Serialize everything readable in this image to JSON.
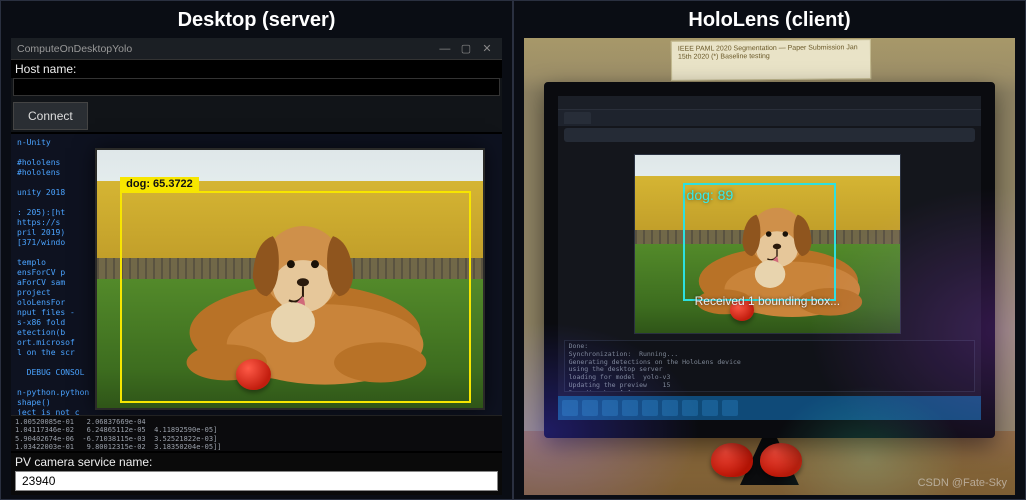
{
  "left": {
    "title": "Desktop (server)",
    "window_title": "ComputeOnDesktopYolo",
    "host_label": "Host name:",
    "connect_label": "Connect",
    "pv_label": "PV camera service name:",
    "pv_value": "23940",
    "detection_label": "dog: 65.3722",
    "code_lines": "n-Unity\n\n#hololens\n#hololens\n\nunity 2018\n\n: 205):[ht\nhttps://s\npril 2019)\n[371/windo\n\ntemplo\nensForCV p\naForCV sam\nproject\noloLensFor\nnput files -\ns-x86 fold\netection(b\nort.microsof\nl on the scr\n\n  DEBUG CONSOL\n\nn-python.python\nshape()\nject is not c\nject\\generate\nn-python.python",
    "terminal_lines": "1.00520085e-01   2.06837669e-04\n1.04117346e-02   6.24865112e-05  4.11892590e-05]\n5.90402674e-06  -6.71038115e-03  3.52521822e-03]\n1.03422003e-01   9.80012315e-02  3.18350204e-05]]\n\nscript\\generate-training-data\\CalibrationBox>"
  },
  "right": {
    "title": "HoloLens (client)",
    "detection_label": "dog: 89",
    "status_text": "Received 1 bounding box...",
    "note_lines": "IEEE  PAML  2020\nSegmentation — Paper Submission Jan 15th 2020\n(*) Baseline testing",
    "terminal_lines": "Done:\nSynchronization:  Running...\nGenerating detections on the HoloLens device\nusing the desktop server\nloading for model  yolo-v3\nUpdating the preview    15\nBounding box [x]:\nSession status:\nRunning inference\nSource file:   msdeploy[hololens-sample]/tensorflow/yolo3v3/assets\nFile path:     /sample-data",
    "watermark": "CSDN @Fate-Sky"
  },
  "icons": {
    "min": "—",
    "max": "▢",
    "close": "✕"
  }
}
